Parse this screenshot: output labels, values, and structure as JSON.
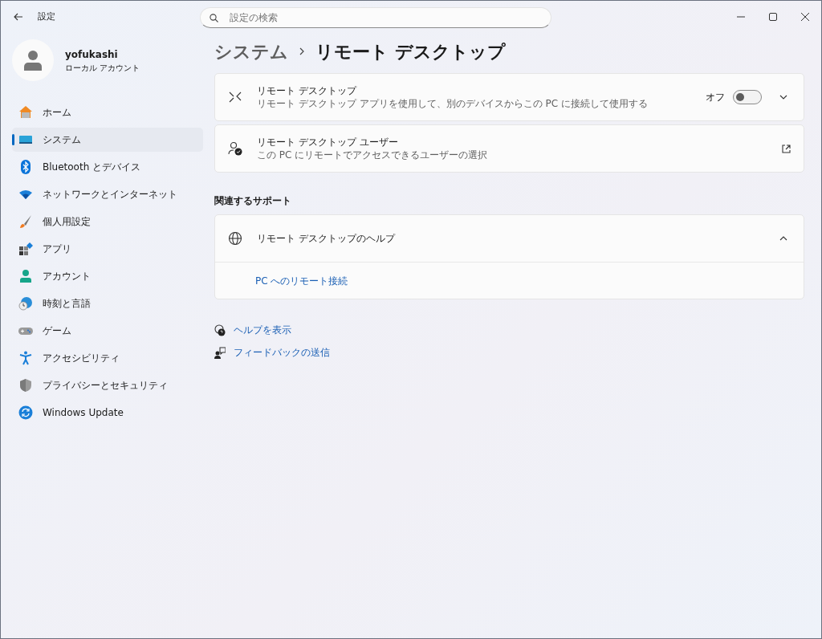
{
  "window": {
    "title": "設定"
  },
  "search": {
    "placeholder": "設定の検索"
  },
  "user": {
    "name": "yofukashi",
    "account_type": "ローカル アカウント"
  },
  "sidebar": {
    "items": [
      {
        "label": "ホーム",
        "selected": false
      },
      {
        "label": "システム",
        "selected": true
      },
      {
        "label": "Bluetooth とデバイス",
        "selected": false
      },
      {
        "label": "ネットワークとインターネット",
        "selected": false
      },
      {
        "label": "個人用設定",
        "selected": false
      },
      {
        "label": "アプリ",
        "selected": false
      },
      {
        "label": "アカウント",
        "selected": false
      },
      {
        "label": "時刻と言語",
        "selected": false
      },
      {
        "label": "ゲーム",
        "selected": false
      },
      {
        "label": "アクセシビリティ",
        "selected": false
      },
      {
        "label": "プライバシーとセキュリティ",
        "selected": false
      },
      {
        "label": "Windows Update",
        "selected": false
      }
    ]
  },
  "breadcrumb": {
    "parent": "システム",
    "current": "リモート デスクトップ"
  },
  "settings": [
    {
      "kind": "toggle",
      "title": "リモート デスクトップ",
      "description": "リモート デスクトップ アプリを使用して、別のデバイスからこの PC に接続して使用する",
      "state_label": "オフ",
      "on": false,
      "expanded": false
    },
    {
      "kind": "link",
      "title": "リモート デスクトップ ユーザー",
      "description": "この PC にリモートでアクセスできるユーザーの選択"
    }
  ],
  "related_support": {
    "heading": "関連するサポート",
    "title": "リモート デスクトップのヘルプ",
    "expanded": true,
    "links": [
      "PC へのリモート接続"
    ]
  },
  "footer_links": [
    "ヘルプを表示",
    "フィードバックの送信"
  ]
}
